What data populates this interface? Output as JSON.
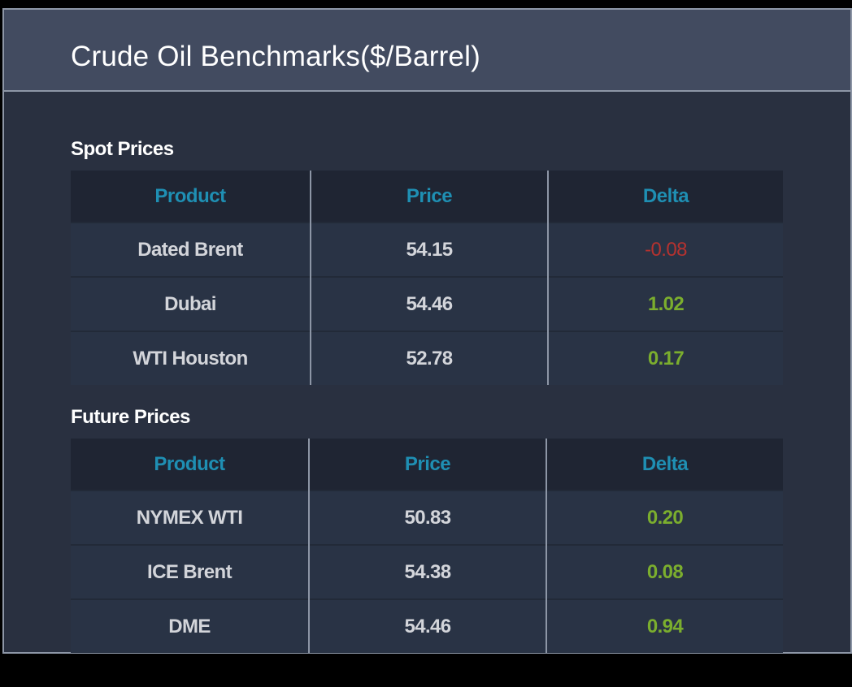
{
  "widget": {
    "title": "Crude Oil Benchmarks($/Barrel)"
  },
  "spot": {
    "title": "Spot Prices",
    "columns": [
      "Product",
      "Price",
      "Delta"
    ],
    "rows": [
      {
        "product": "Dated Brent",
        "price": "54.15",
        "delta": "-0.08"
      },
      {
        "product": "Dubai",
        "price": "54.46",
        "delta": "1.02"
      },
      {
        "product": "WTI Houston",
        "price": "52.78",
        "delta": "0.17"
      }
    ]
  },
  "future": {
    "title": "Future Prices",
    "columns": [
      "Product",
      "Price",
      "Delta"
    ],
    "rows": [
      {
        "product": "NYMEX WTI",
        "price": "50.83",
        "delta": "0.20"
      },
      {
        "product": "ICE Brent",
        "price": "54.38",
        "delta": "0.08"
      },
      {
        "product": "DME",
        "price": "54.46",
        "delta": "0.94"
      }
    ]
  },
  "colors": {
    "header_bg": "#424b60",
    "panel_bg": "#293040",
    "column_header_text": "#1f8fb3",
    "positive_delta": "#7bae2e",
    "negative_delta": "#b5322f"
  }
}
